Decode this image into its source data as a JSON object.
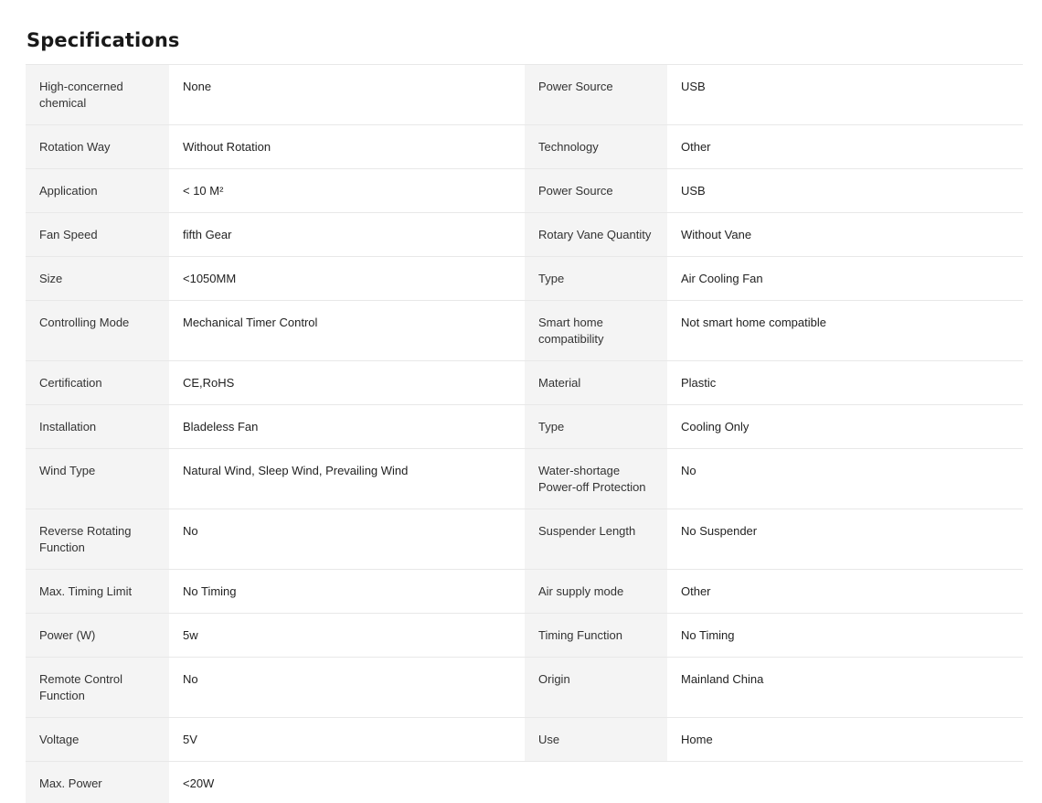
{
  "section": {
    "title": "Specifications"
  },
  "rows": [
    {
      "k1": "High-concerned chemical",
      "v1": "None",
      "k2": "Power Source",
      "v2": "USB"
    },
    {
      "k1": "Rotation Way",
      "v1": "Without Rotation",
      "k2": "Technology",
      "v2": "Other"
    },
    {
      "k1": "Application",
      "v1": "< 10 M²",
      "k2": "Power Source",
      "v2": "USB"
    },
    {
      "k1": "Fan Speed",
      "v1": "fifth Gear",
      "k2": "Rotary Vane Quantity",
      "v2": "Without Vane"
    },
    {
      "k1": "Size",
      "v1": "<1050MM",
      "k2": "Type",
      "v2": "Air Cooling Fan"
    },
    {
      "k1": "Controlling Mode",
      "v1": "Mechanical Timer Control",
      "k2": "Smart home compatibility",
      "v2": "Not smart home compatible"
    },
    {
      "k1": "Certification",
      "v1": "CE,RoHS",
      "k2": "Material",
      "v2": "Plastic"
    },
    {
      "k1": "Installation",
      "v1": "Bladeless Fan",
      "k2": "Type",
      "v2": "Cooling Only"
    },
    {
      "k1": "Wind Type",
      "v1": "Natural Wind, Sleep Wind, Prevailing Wind",
      "k2": "Water-shortage Power-off Protection",
      "v2": "No"
    },
    {
      "k1": "Reverse Rotating Function",
      "v1": "No",
      "k2": "Suspender Length",
      "v2": "No Suspender"
    },
    {
      "k1": "Max. Timing Limit",
      "v1": "No Timing",
      "k2": "Air supply mode",
      "v2": "Other"
    },
    {
      "k1": "Power (W)",
      "v1": "5w",
      "k2": "Timing Function",
      "v2": "No Timing"
    },
    {
      "k1": "Remote Control Function",
      "v1": "No",
      "k2": "Origin",
      "v2": "Mainland China"
    },
    {
      "k1": "Voltage",
      "v1": "5V",
      "k2": "Use",
      "v2": "Home"
    },
    {
      "k1": "Max. Power",
      "v1": "<20W",
      "k2": "",
      "v2": ""
    }
  ]
}
